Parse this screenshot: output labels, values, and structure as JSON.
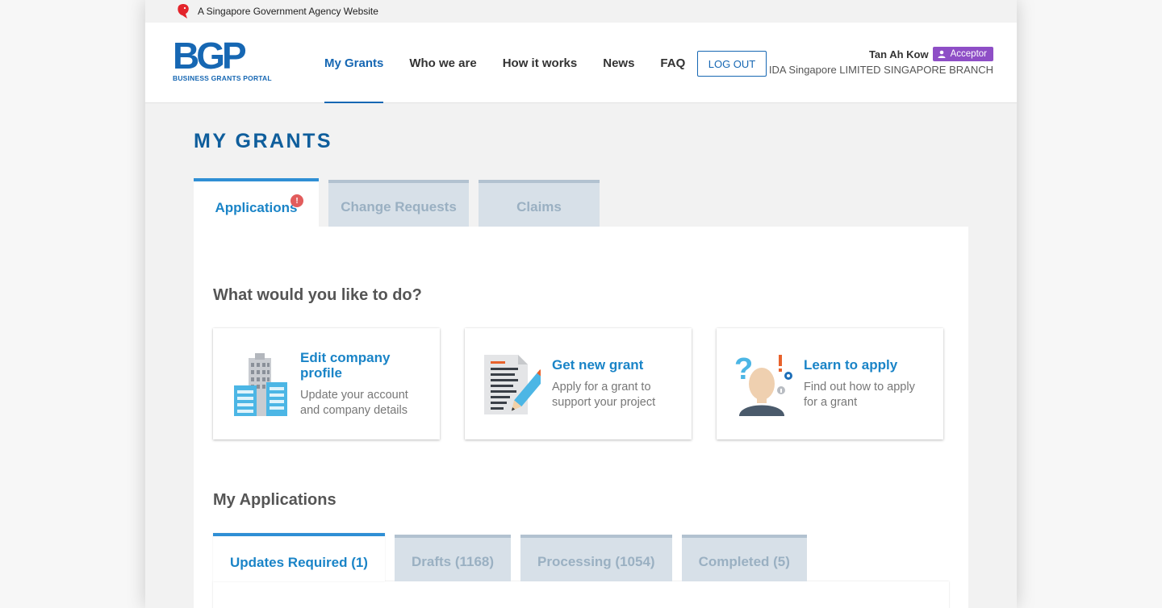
{
  "masthead": {
    "text": "A Singapore Government Agency Website",
    "icon": "lion-head-icon"
  },
  "logo": {
    "mark": "BGP",
    "subtitle": "BUSINESS GRANTS PORTAL"
  },
  "nav": {
    "items": [
      {
        "label": "My Grants",
        "active": true
      },
      {
        "label": "Who we are"
      },
      {
        "label": "How it works"
      },
      {
        "label": "News"
      },
      {
        "label": "FAQ"
      }
    ],
    "logout_label": "LOG OUT"
  },
  "user": {
    "name": "Tan Ah Kow",
    "role": "Acceptor",
    "role_icon": "user-icon",
    "org": "IDA Singapore LIMITED SINGAPORE BRANCH"
  },
  "page": {
    "title": "MY GRANTS"
  },
  "tabs": [
    {
      "label": "Applications",
      "active": true,
      "alert": "!"
    },
    {
      "label": "Change Requests"
    },
    {
      "label": "Claims"
    }
  ],
  "actions": {
    "heading": "What would you like to do?",
    "cards": [
      {
        "title_line1": "Edit company",
        "title_line2": "profile",
        "desc_line1": "Update your account",
        "desc_line2": "and company details",
        "icon": "building-icon"
      },
      {
        "title_line1": "Get new grant",
        "desc_line1": "Apply for a grant to",
        "desc_line2": "support your project",
        "icon": "document-pencil-icon"
      },
      {
        "title_line1": "Learn to apply",
        "desc_line1": "Find out how to apply",
        "desc_line2": "for a grant",
        "icon": "person-question-icon"
      }
    ]
  },
  "applications": {
    "heading": "My Applications",
    "tabs": [
      {
        "label": "Updates Required (1)",
        "active": true
      },
      {
        "label": "Drafts (1168)"
      },
      {
        "label": "Processing (1054)"
      },
      {
        "label": "Completed (5)"
      }
    ]
  },
  "colors": {
    "primary": "#1667b3",
    "accent": "#1a84c7",
    "badge": "#8e4ec6",
    "alert": "#e25c5c"
  }
}
